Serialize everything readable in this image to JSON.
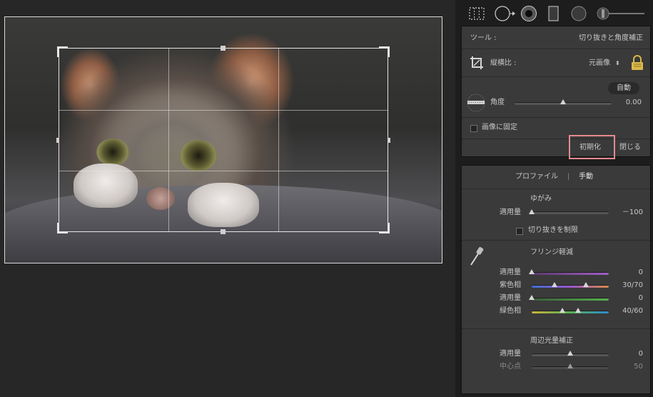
{
  "tools": {
    "tool_label": "ツール :",
    "tool_value": "切り抜きと角度補正",
    "aspect_label": "縦横比 :",
    "aspect_value": "元画像",
    "auto_button": "自動",
    "angle_label": "角度",
    "angle_value": "0.00",
    "constrain_label": "画像に固定",
    "reset_button": "初期化",
    "close_button": "閉じる"
  },
  "lens": {
    "tab_profile": "プロファイル",
    "tab_separator": "|",
    "tab_manual": "手動",
    "distortion_title": "ゆがみ",
    "distortion_amount_label": "適用量",
    "distortion_amount_value": "－100",
    "constrain_crop_label": "切り抜きを制限",
    "fringe_title": "フリンジ軽減",
    "purple_amount_label": "適用量",
    "purple_amount_value": "0",
    "purple_hue_label": "紫色相",
    "purple_hue_value": "30/70",
    "green_amount_label": "適用量",
    "green_amount_value": "0",
    "green_hue_label": "緑色相",
    "green_hue_value": "40/60",
    "vignette_title": "周辺光量補正",
    "vignette_amount_label": "適用量",
    "vignette_amount_value": "0",
    "midpoint_label": "中心点",
    "midpoint_value": "50"
  },
  "colors": {
    "highlight": "#e58a90",
    "panel_bg": "#3a3a3a"
  },
  "slider_levels": {
    "angle": 0.5,
    "distortion_amount": 0.0,
    "purple_amount": 0.0,
    "purple_hue_low": 0.3,
    "purple_hue_high": 0.7,
    "green_amount": 0.0,
    "green_hue_low": 0.4,
    "green_hue_high": 0.6,
    "vignette_amount": 0.5,
    "midpoint": 0.5
  }
}
